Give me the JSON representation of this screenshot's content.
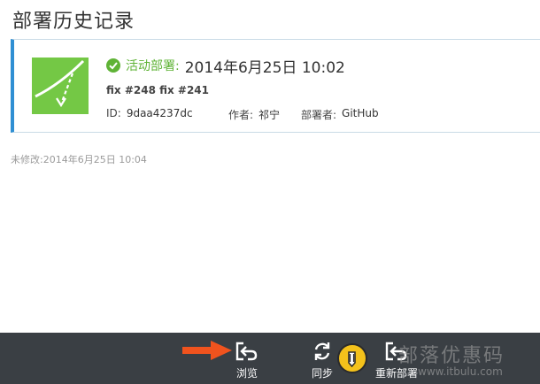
{
  "page": {
    "title": "部署历史记录"
  },
  "deployment": {
    "status_label": "活动部署:",
    "time": "2014年6月25日 10:02",
    "commit_message": "fix #248 fix #241",
    "id_label": "ID:",
    "id_value": "9daa4237dc",
    "author_label": "作者:",
    "author_value": "祁宁",
    "deployer_label": "部署者:",
    "deployer_value": "GitHub",
    "icon": "deploy-site-icon",
    "thumb_color": "#74c845",
    "status_color": "#5fb336"
  },
  "modified": {
    "text": "未修改:2014年6月25日 10:04"
  },
  "command_bar": {
    "background": "#3a3f44",
    "buttons": [
      {
        "label": "浏览",
        "icon": "browse-icon"
      },
      {
        "label": "同步",
        "icon": "sync-icon"
      },
      {
        "label": "重新部署",
        "icon": "redeploy-icon"
      }
    ]
  },
  "annotation": {
    "arrow_color": "#f0531e",
    "icon": "red-arrow-icon"
  },
  "watermark": {
    "text": "部落优惠码",
    "url": "www.itbulu.com",
    "icon": "pencil-badge-icon"
  }
}
